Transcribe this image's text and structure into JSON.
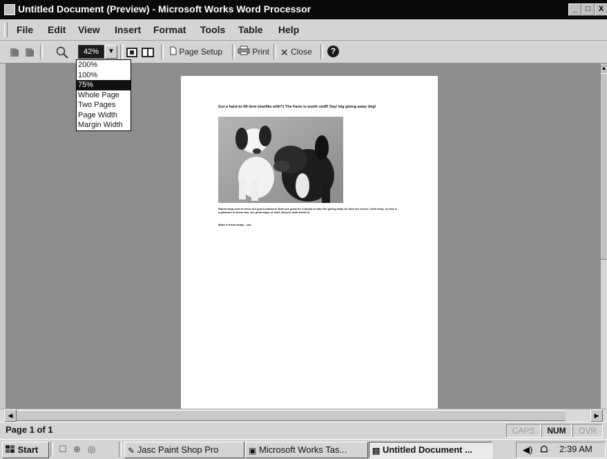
{
  "window": {
    "title": "Untitled Document (Preview) - Microsoft Works Word Processor",
    "controls": [
      "_",
      "□",
      "X"
    ]
  },
  "menu": [
    {
      "label": "File"
    },
    {
      "label": "Edit"
    },
    {
      "label": "View"
    },
    {
      "label": "Insert"
    },
    {
      "label": "Format"
    },
    {
      "label": "Tools"
    },
    {
      "label": "Table"
    },
    {
      "label": "Help"
    }
  ],
  "toolbar": {
    "zoom_value": "42%",
    "page_setup_label": "Page Setup",
    "print_label": "Print",
    "close_label": "Close",
    "help_symbol": "?"
  },
  "zoom_menu": {
    "options": [
      "200%",
      "100%",
      "75%",
      "Whole Page",
      "Two Pages",
      "Page Width",
      "Margin Width"
    ],
    "selected_index": 2
  },
  "document": {
    "heading": "Got a hard-to-fill item (me/like with?) The Farm is worth stuff! Say! big giving away dog!",
    "body1": "Haired dogs and to these are good outdoors! Both are great for a family to take the giving away to! Also the scenic. Gold shop. so this is a pleasure of these two. are great ways of stuff. (they're both worth it)",
    "body2": "Make a friend today - call"
  },
  "status": {
    "page_info": "Page 1 of 1",
    "indicators": [
      "CAPS",
      "NUM",
      "OVR"
    ]
  },
  "taskbar": {
    "start_label": "Start",
    "buttons": [
      "Jasc Paint Shop Pro",
      "Microsoft Works Tas...",
      "Untitled Document ..."
    ],
    "clock": "2:39 AM"
  },
  "colors": {
    "titlebar": "#0a0a0a",
    "chrome": "#d4d4d4",
    "workspace": "#8d8d8d",
    "page": "#ffffff"
  }
}
